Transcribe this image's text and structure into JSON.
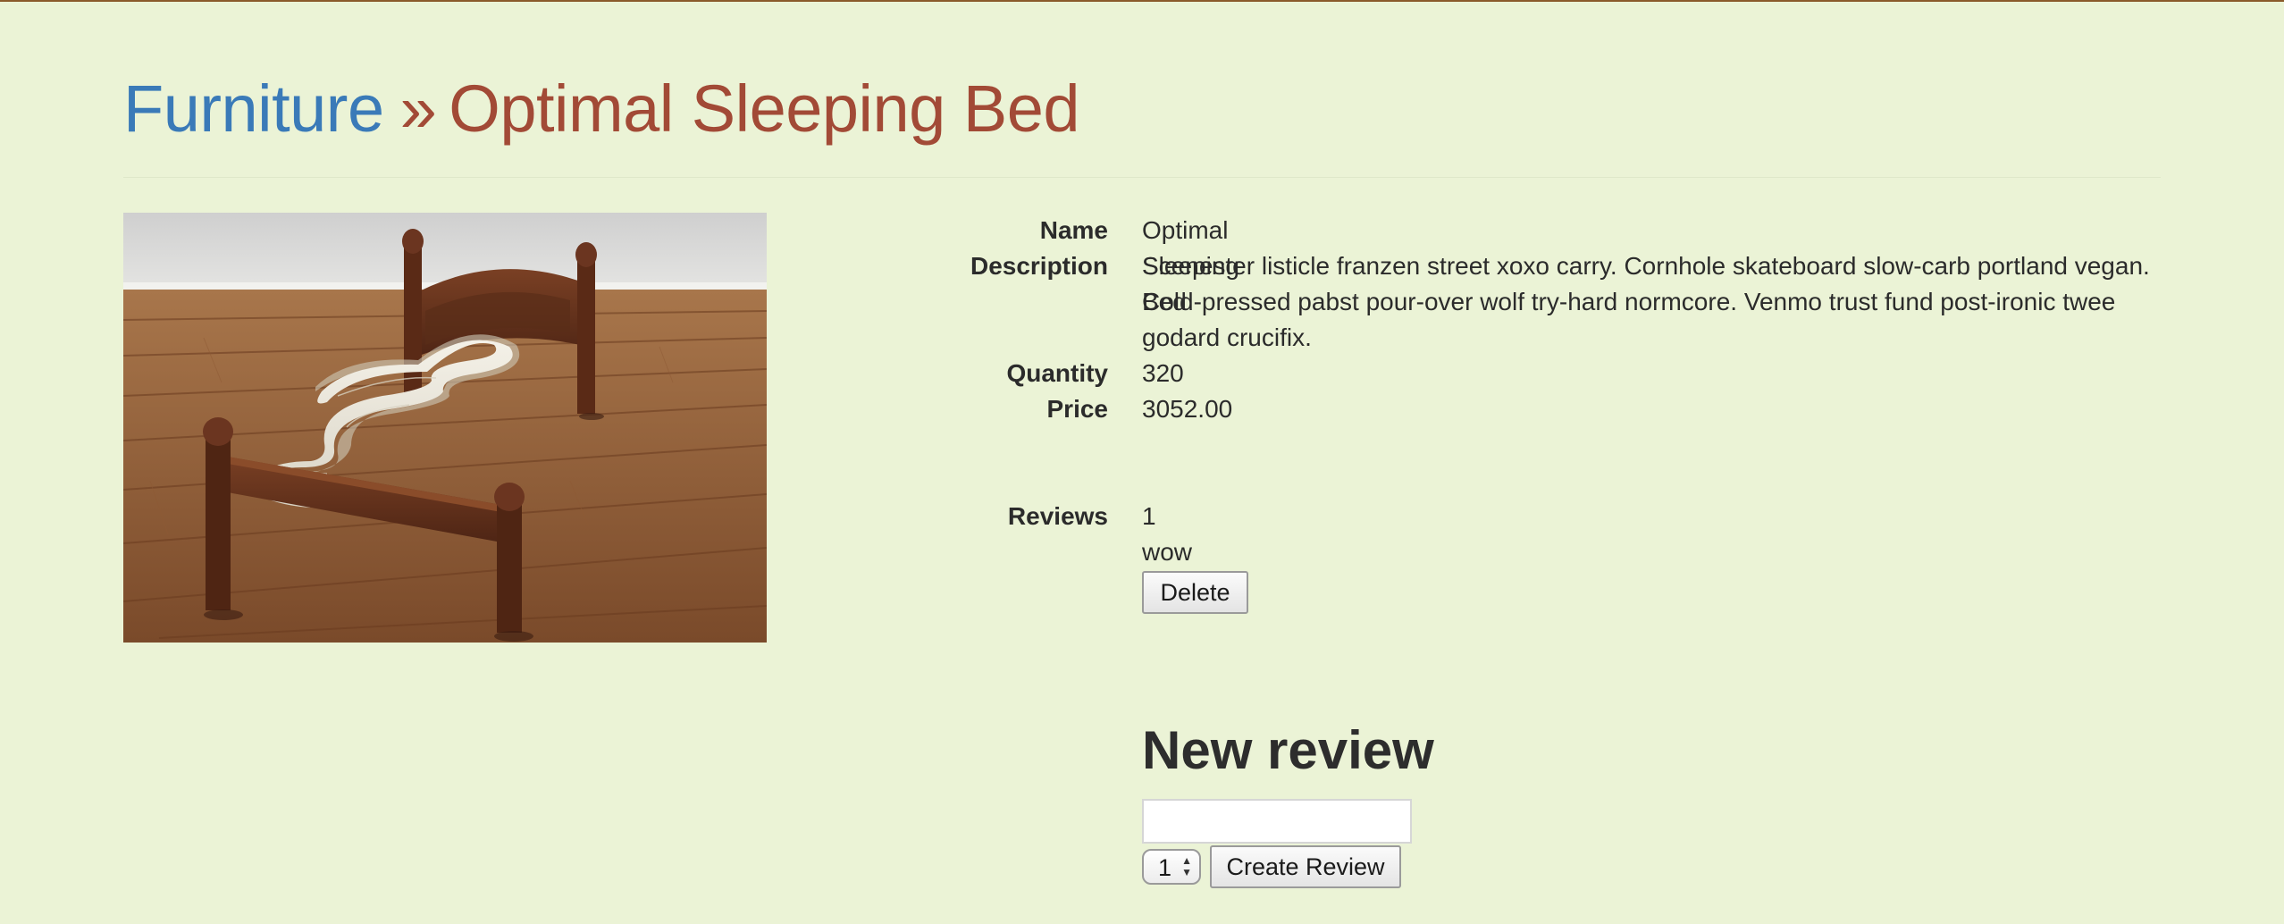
{
  "breadcrumb": {
    "category": "Furniture",
    "separator": "»",
    "current": "Optimal Sleeping Bed"
  },
  "product": {
    "image_alt": "S-shaped wooden bed with curved mattress on hardwood floor",
    "fields": {
      "name_label": "Name",
      "name_value": "Optimal Sleeping Bed",
      "description_label": "Description",
      "description_value": "Scenester listicle franzen street xoxo carry. Cornhole skateboard slow-carb portland vegan. Cold-pressed pabst pour-over wolf try-hard normcore. Venmo trust fund post-ironic twee godard crucifix.",
      "quantity_label": "Quantity",
      "quantity_value": "320",
      "price_label": "Price",
      "price_value": "3052.00"
    }
  },
  "reviews": {
    "label": "Reviews",
    "items": [
      {
        "rating": "1",
        "text": "wow",
        "delete_label": "Delete"
      }
    ]
  },
  "new_review": {
    "title": "New review",
    "text_value": "",
    "rating_selected": "1",
    "submit_label": "Create Review"
  },
  "colors": {
    "background": "#ebf3d6",
    "link_blue": "#3a7ab8",
    "title_red": "#a24a36"
  }
}
